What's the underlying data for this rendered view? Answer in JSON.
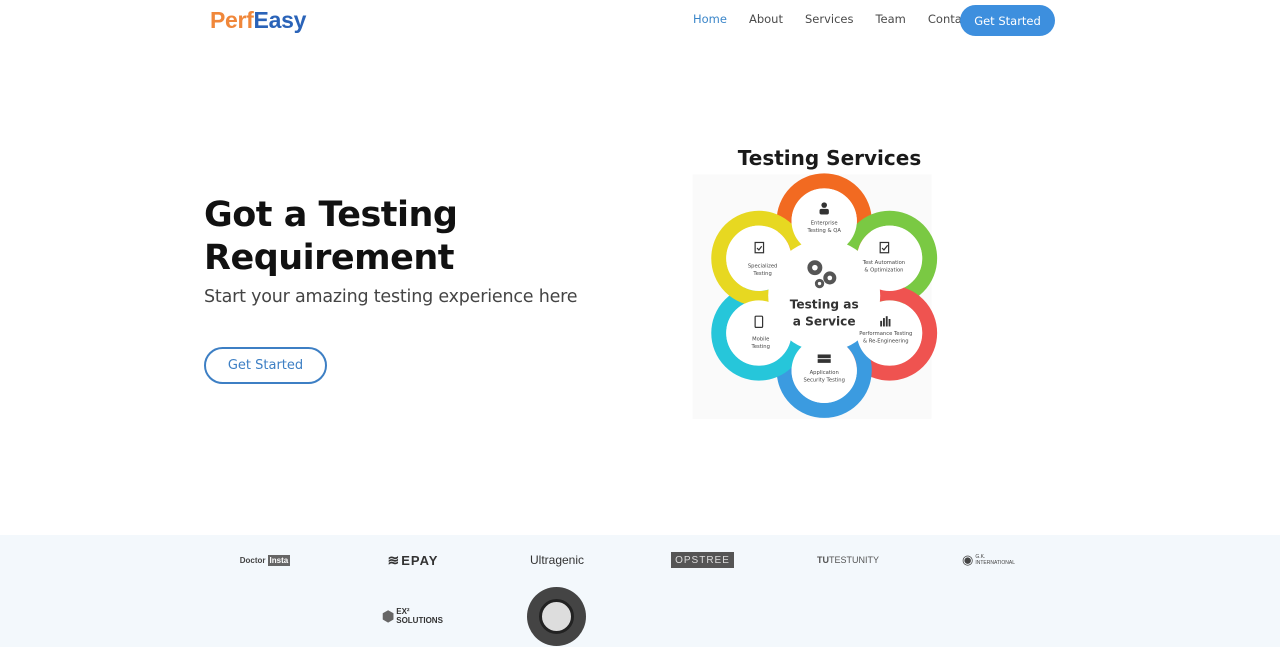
{
  "brand": {
    "part1": "Perf",
    "part2": "Easy"
  },
  "nav": {
    "items": [
      {
        "label": "Home",
        "active": true
      },
      {
        "label": "About",
        "active": false
      },
      {
        "label": "Services",
        "active": false
      },
      {
        "label": "Team",
        "active": false
      },
      {
        "label": "Contact",
        "active": false
      }
    ],
    "cta_label": "Get Started"
  },
  "hero": {
    "title_line1": "Got a Testing",
    "title_line2": "Requirement",
    "subtitle": "Start your amazing testing experience here",
    "button_label": "Get Started"
  },
  "diagram": {
    "title": "Testing Services",
    "center_line1": "Testing as",
    "center_line2": "a Service",
    "petals": [
      {
        "line1": "Enterprise",
        "line2": "Testing & QA",
        "color": "#f26a21"
      },
      {
        "line1": "Test Automation",
        "line2": "& Optimization",
        "color": "#7ac943"
      },
      {
        "line1": "Performance Testing",
        "line2": "& Re-Engineering",
        "color": "#ef5350"
      },
      {
        "line1": "Application",
        "line2": "Security Testing",
        "color": "#3b9be0"
      },
      {
        "line1": "Mobile",
        "line2": "Testing",
        "color": "#26c6da"
      },
      {
        "line1": "Specialized",
        "line2": "Testing",
        "color": "#e7d821"
      }
    ]
  },
  "clients": {
    "logos": [
      {
        "name": "Doctor",
        "badge": "Insta"
      },
      {
        "name": "EPAY"
      },
      {
        "name": "Ultragenic"
      },
      {
        "name": "OPSTREE"
      },
      {
        "name": "TESTUNITY",
        "prefix": "TU"
      },
      {
        "name": "G.K. INTERNATIONAL"
      },
      {
        "name": "EX² SOLUTIONS"
      }
    ]
  }
}
